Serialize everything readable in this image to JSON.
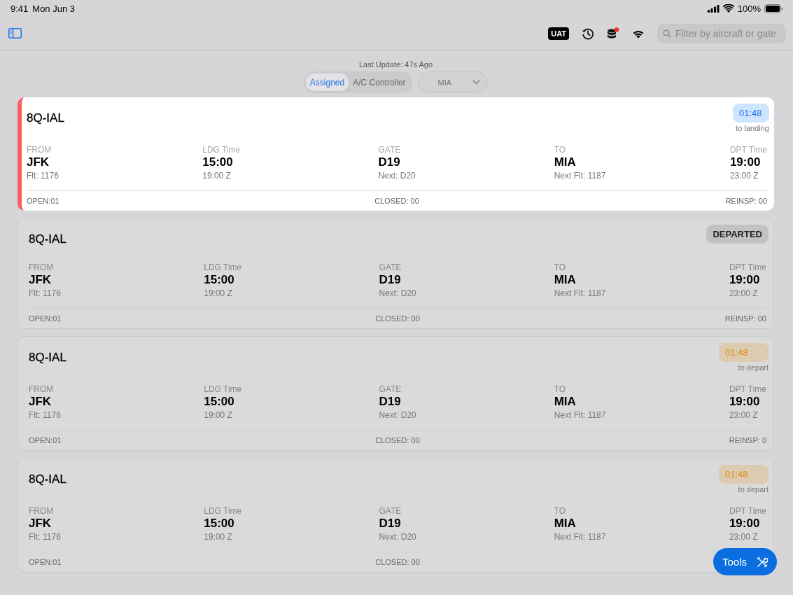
{
  "status_bar": {
    "time": "9:41",
    "date": "Mon Jun 3",
    "battery": "100%"
  },
  "toolbar": {
    "env_badge": "UAT",
    "db_alert": true,
    "search": {
      "placeholder": "Filter by aircraft or gate"
    }
  },
  "last_update": "Last Update: 47s Ago",
  "segments": [
    {
      "label": "Assigned",
      "selected": true
    },
    {
      "label": "A/C Controller",
      "selected": false
    }
  ],
  "station": {
    "value": "MIA"
  },
  "cards": [
    {
      "selected": true,
      "tail": "8Q-IAL",
      "badge": {
        "kind": "landing",
        "text": "01:48",
        "caption": "to landing"
      },
      "fields": [
        {
          "label": "FROM",
          "value": "JFK",
          "sub": "Flt: 1176"
        },
        {
          "label": "LDG Time",
          "value": "15:00",
          "sub": "19:00 Z"
        },
        {
          "label": "GATE",
          "value": "D19",
          "sub": "Next: D20"
        },
        {
          "label": "TO",
          "value": "MIA",
          "sub": "Next Flt: 1187"
        },
        {
          "label": "DPT Time",
          "value": "19:00",
          "sub": "23:00 Z"
        }
      ],
      "footer": {
        "open": "OPEN:01",
        "closed": "CLOSED: 00",
        "reinsp": "REINSP: 00"
      }
    },
    {
      "selected": false,
      "tail": "8Q-IAL",
      "badge": {
        "kind": "departed",
        "text": "DEPARTED"
      },
      "fields": [
        {
          "label": "FROM",
          "value": "JFK",
          "sub": "Flt: 1176"
        },
        {
          "label": "LDG Time",
          "value": "15:00",
          "sub": "19:00 Z"
        },
        {
          "label": "GATE",
          "value": "D19",
          "sub": "Next: D20"
        },
        {
          "label": "TO",
          "value": "MIA",
          "sub": "Next Flt: 1187"
        },
        {
          "label": "DPT Time",
          "value": "19:00",
          "sub": "23:00 Z"
        }
      ],
      "footer": {
        "open": "OPEN:01",
        "closed": "CLOSED: 00",
        "reinsp": "REINSP: 00"
      }
    },
    {
      "selected": false,
      "tail": "8Q-IAL",
      "badge": {
        "kind": "depart",
        "text": "01:48",
        "caption": "to depart"
      },
      "fields": [
        {
          "label": "FROM",
          "value": "JFK",
          "sub": "Flt: 1176"
        },
        {
          "label": "LDG Time",
          "value": "15:00",
          "sub": "19:00 Z"
        },
        {
          "label": "GATE",
          "value": "D19",
          "sub": "Next: D20"
        },
        {
          "label": "TO",
          "value": "MIA",
          "sub": "Next Flt: 1187"
        },
        {
          "label": "DPT Time",
          "value": "19:00",
          "sub": "23:00 Z"
        }
      ],
      "footer": {
        "open": "OPEN:01",
        "closed": "CLOSED: 00",
        "reinsp": "REINSP: 0"
      }
    },
    {
      "selected": false,
      "tail": "8Q-IAL",
      "badge": {
        "kind": "depart",
        "text": "01:48",
        "caption": "to depart"
      },
      "fields": [
        {
          "label": "FROM",
          "value": "JFK",
          "sub": "Flt: 1176"
        },
        {
          "label": "LDG Time",
          "value": "15:00",
          "sub": "19:00 Z"
        },
        {
          "label": "GATE",
          "value": "D19",
          "sub": "Next: D20"
        },
        {
          "label": "TO",
          "value": "MIA",
          "sub": "Next Flt: 1187"
        },
        {
          "label": "DPT Time",
          "value": "19:00",
          "sub": "23:00 Z"
        }
      ],
      "footer": {
        "open": "OPEN:01",
        "closed": "CLOSED: 00"
      }
    }
  ],
  "tools_button": {
    "label": "Tools"
  }
}
